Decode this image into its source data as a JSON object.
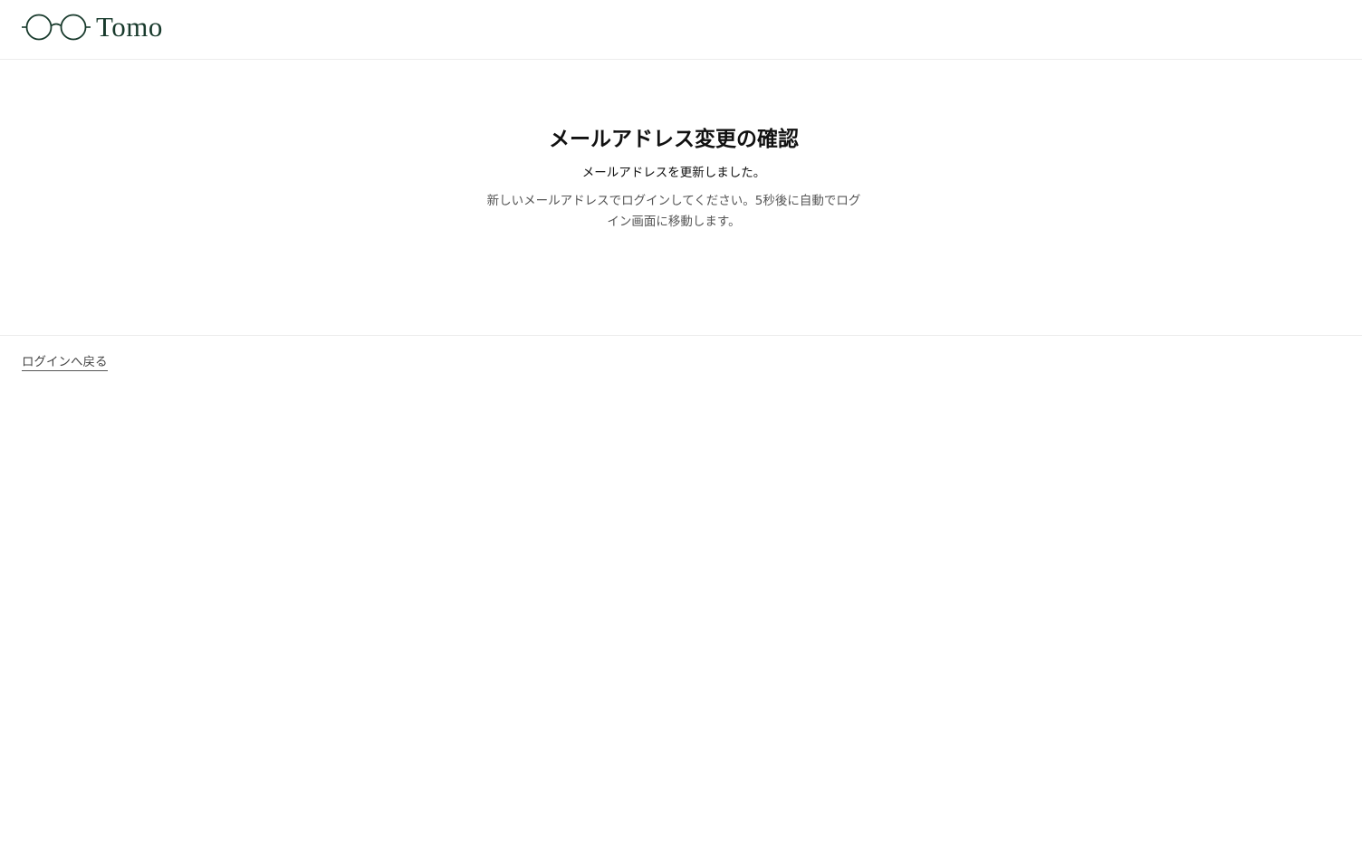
{
  "header": {
    "logo_text": "Tomo"
  },
  "main": {
    "title": "メールアドレス変更の確認",
    "message": "メールアドレスを更新しました。",
    "description": "新しいメールアドレスでログインしてください。5秒後に自動でログイン画面に移動します。"
  },
  "footer": {
    "back_link_label": "ログインへ戻る"
  },
  "colors": {
    "brand": "#183a2c",
    "text": "#111111",
    "muted_text": "#555555",
    "divider": "#ececec"
  },
  "icons": {
    "logo_mark": "glasses-icon"
  }
}
